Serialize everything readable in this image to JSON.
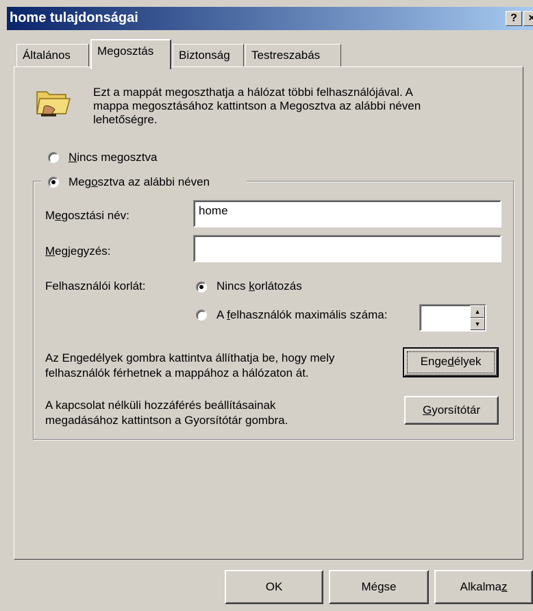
{
  "window": {
    "title": "home tulajdonságai",
    "help_label": "?",
    "close_label": "×"
  },
  "tabs": [
    {
      "label": "Általános",
      "active": false
    },
    {
      "label": "Megosztás",
      "active": true
    },
    {
      "label": "Biztonság",
      "active": false
    },
    {
      "label": "Testreszabás",
      "active": false
    }
  ],
  "sharing": {
    "intro_line1": "Ezt a mappát megoszthatja a hálózat többi felhasználójával.  A",
    "intro_line2": "mappa megosztásához kattintson a Megosztva az alábbi néven",
    "intro_line3": "lehetőségre.",
    "not_shared_label_u": "N",
    "not_shared_label_rest": "incs megosztva",
    "shared_as_label_pre": "Meg",
    "shared_as_label_u": "o",
    "shared_as_label_post": "sztva az alábbi néven",
    "share_name_label_pre": "M",
    "share_name_label_u": "e",
    "share_name_label_post": "gosztási név:",
    "share_name_value": "home",
    "comment_label_u": "M",
    "comment_label_post": "egjegyzés:",
    "comment_value": "",
    "user_limit_label": "Felhasználói korlát:",
    "no_limit_pre": "Nincs ",
    "no_limit_u": "k",
    "no_limit_post": "orlátozás",
    "max_users_pre": "A ",
    "max_users_u": "f",
    "max_users_post": "elhasználók maximális száma:",
    "max_users_value": "",
    "permissions_text1": "Az Engedélyek gombra kattintva állíthatja be, hogy mely",
    "permissions_text2": "felhasználók férhetnek a mappához a hálózaton át.",
    "permissions_btn_pre": "Enge",
    "permissions_btn_u": "d",
    "permissions_btn_post": "élyek",
    "caching_text1": "A kapcsolat nélküli hozzáférés beállításainak",
    "caching_text2": "megadásához kattintson a Gyorsítótár gombra.",
    "caching_btn_u": "G",
    "caching_btn_post": "yorsítótár"
  },
  "footer": {
    "ok_label": "OK",
    "cancel_label": "Mégse",
    "apply_pre": "Alkalma",
    "apply_u": "z"
  }
}
